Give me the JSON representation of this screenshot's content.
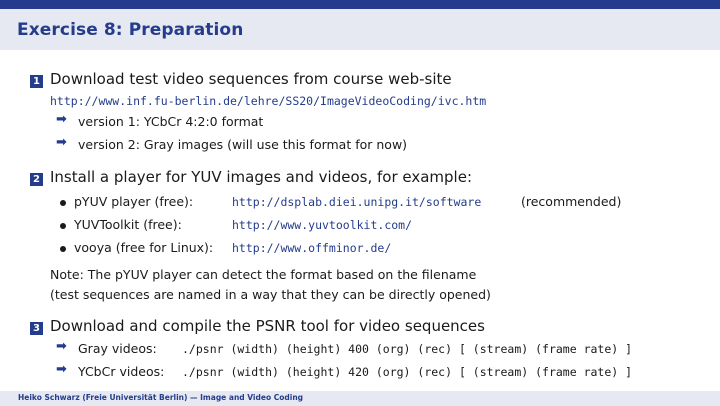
{
  "header": {
    "title": "Exercise 8:  Preparation"
  },
  "steps": [
    {
      "number": "1",
      "text": "Download test video sequences from course web-site",
      "url": "http://www.inf.fu-berlin.de/lehre/SS20/ImageVideoCoding/ivc.htm",
      "items": [
        "version 1: YCbCr 4:2:0 format",
        "version 2: Gray images (will use this format for now)"
      ]
    },
    {
      "number": "2",
      "text": "Install a player for YUV images and videos, for example:",
      "players": [
        {
          "name": "pYUV player (free):",
          "url": "http://dsplab.diei.unipg.it/software",
          "note": "(recommended)"
        },
        {
          "name": "YUVToolkit (free):",
          "url": "http://www.yuvtoolkit.com/",
          "note": ""
        },
        {
          "name": "vooya (free for Linux):",
          "url": "http://www.offminor.de/",
          "note": ""
        }
      ],
      "note_line1": "Note:  The pYUV player can detect the format based on the filename",
      "note_line2": "(test sequences are named in a way that they can be directly opened)"
    },
    {
      "number": "3",
      "text": "Download and compile the PSNR tool for video sequences",
      "commands": [
        {
          "label": "Gray videos:",
          "cmd": "./psnr (width) (height) 400 (org) (rec) [ (stream) (frame rate) ]"
        },
        {
          "label": "YCbCr videos:",
          "cmd": "./psnr (width) (height) 420 (org) (rec) [ (stream) (frame rate) ]"
        }
      ]
    }
  ],
  "footer": {
    "text": "Heiko Schwarz (Freie Universität Berlin) — Image and Video Coding"
  },
  "icons": {
    "arrow": "right-arrow-icon",
    "bullet": "bullet-icon"
  },
  "colors": {
    "accent": "#243c8c",
    "bar": "#e6e9f1"
  }
}
